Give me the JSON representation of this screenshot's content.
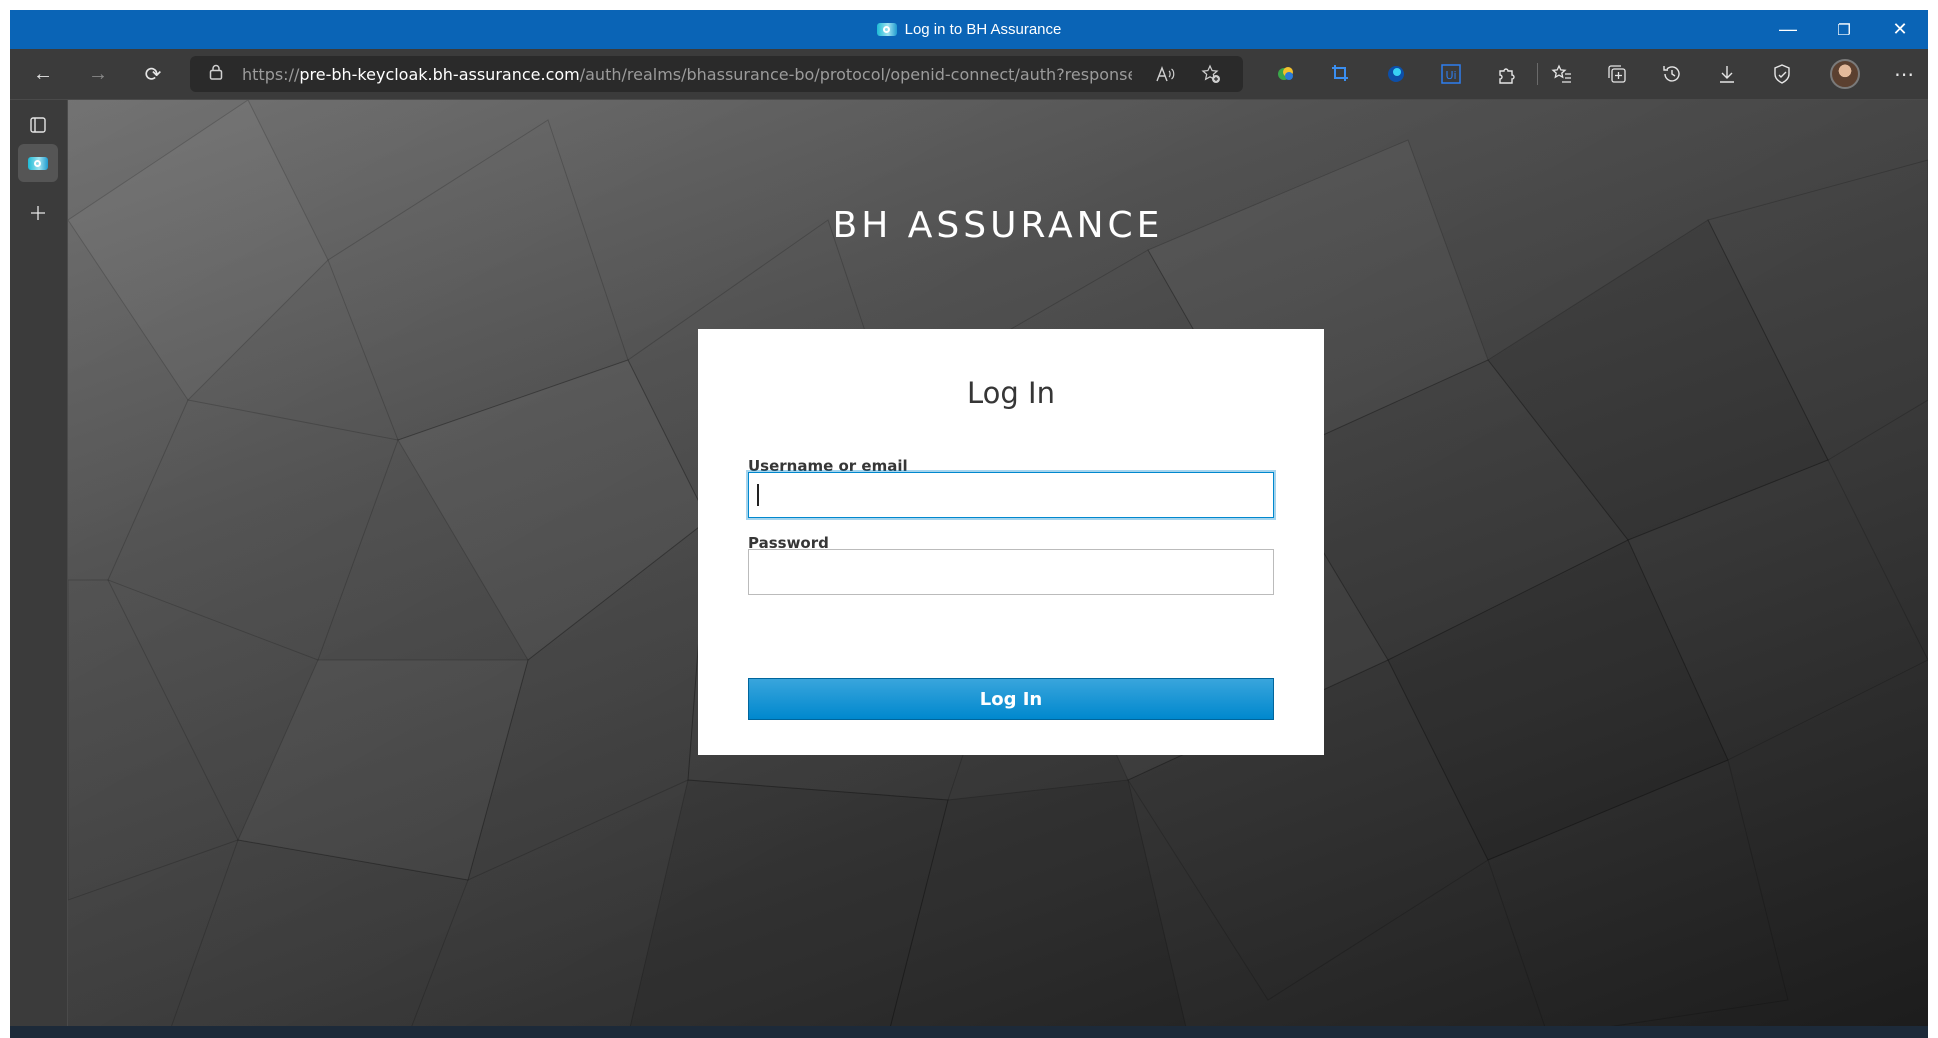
{
  "window": {
    "title": "Log in to BH Assurance",
    "controls": {
      "minimize": "—",
      "restore": "❐",
      "close": "✕"
    }
  },
  "toolbar": {
    "back_icon": "←",
    "forward_icon": "→",
    "refresh_icon": "⟳",
    "url_scheme": "https://",
    "url_host": "pre-bh-keycloak.bh-assurance.com",
    "url_path": "/auth/realms/bhassurance-bo/protocol/openid-connect/auth?response...",
    "read_aloud": "Â",
    "more_icon": "⋯"
  },
  "sidebar": {
    "items": [
      {
        "name": "tab-actions",
        "icon": "▢"
      },
      {
        "name": "active-tab",
        "icon": "favicon"
      },
      {
        "name": "new-tab",
        "icon": "+"
      }
    ]
  },
  "page": {
    "brand": "BH ASSURANCE",
    "heading": "Log In",
    "username_label": "Username or email",
    "username_value": "",
    "password_label": "Password",
    "password_value": "",
    "submit_label": "Log In"
  },
  "colors": {
    "titlebar": "#0a64b6",
    "accent": "#0088ce"
  }
}
